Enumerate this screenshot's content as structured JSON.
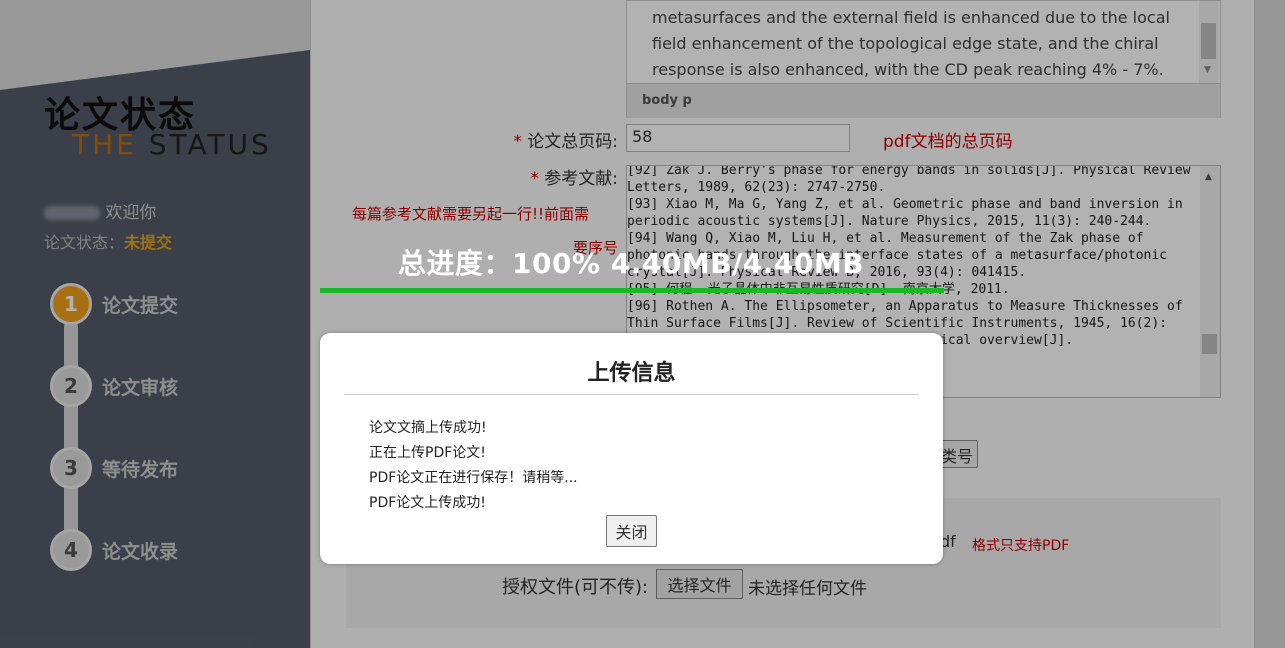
{
  "sidebar": {
    "logo_cn": "论文状态",
    "logo_en_first": "THE",
    "logo_en_rest": "STATUS",
    "welcome": "欢迎你",
    "status_label": "论文状态：",
    "status_value": "未提交",
    "steps": [
      {
        "num": "1",
        "label": "论文提交"
      },
      {
        "num": "2",
        "label": "论文审核"
      },
      {
        "num": "3",
        "label": "等待发布"
      },
      {
        "num": "4",
        "label": "论文收录"
      }
    ]
  },
  "form": {
    "abstract_text": "metasurfaces and the external field is enhanced due to the local field enhancement of the topological edge state, and the chiral response is also enhanced, with the CD peak reaching 4% - 7%.",
    "editor_path": "body   p",
    "pages_label": "论文总页码:",
    "pages_value": "58",
    "pages_hint": "pdf文档的总页码",
    "refs_label": "参考文献:",
    "refs_hint_1": "每篇参考文献需要另起一行!!前面需",
    "refs_hint_2": "要序号",
    "references": "[92] Zak J. Berry's phase for energy bands in solids[J]. Physical Review Letters, 1989, 62(23): 2747-2750.\n[93] Xiao M, Ma G, Yang Z, et al. Geometric phase and band inversion in periodic acoustic systems[J]. Nature Physics, 2015, 11(3): 240-244.\n[94] Wang Q, Xiao M, Liu H, et al. Measurement of the Zak phase of photonic bands through the interface states of a metasurface/photonic crystal[J]. Physical Review B, 2016, 93(4): 041415.\n[95] 何程. 光子晶体中非互易性质研究[D]. 南京大学, 2011.\n[96] Rothen A. The Ellipsometer, an Apparatus to Measure Thicknesses of Thin Surface Films[J]. Review of Scientific Instruments, 1945, 16(2):\n[97] Azzam R M A. Ellipsometry: a historical overview[J].",
    "partial_button": "类号",
    "pdf_suffix": "df",
    "pdf_hint": "格式只支持PDF",
    "auth_label": "授权文件(可不传):",
    "choose_file": "选择文件",
    "no_file": "未选择任何文件"
  },
  "progress": {
    "label": "总进度：100%  4.40MB/4.40MB",
    "fraction": 1.0,
    "color": "#19b82a"
  },
  "dialog": {
    "title": "上传信息",
    "messages": [
      "论文文摘上传成功!",
      "正在上传PDF论文!",
      "PDF论文正在进行保存！请稍等...",
      "PDF论文上传成功!"
    ],
    "close": "关闭"
  }
}
